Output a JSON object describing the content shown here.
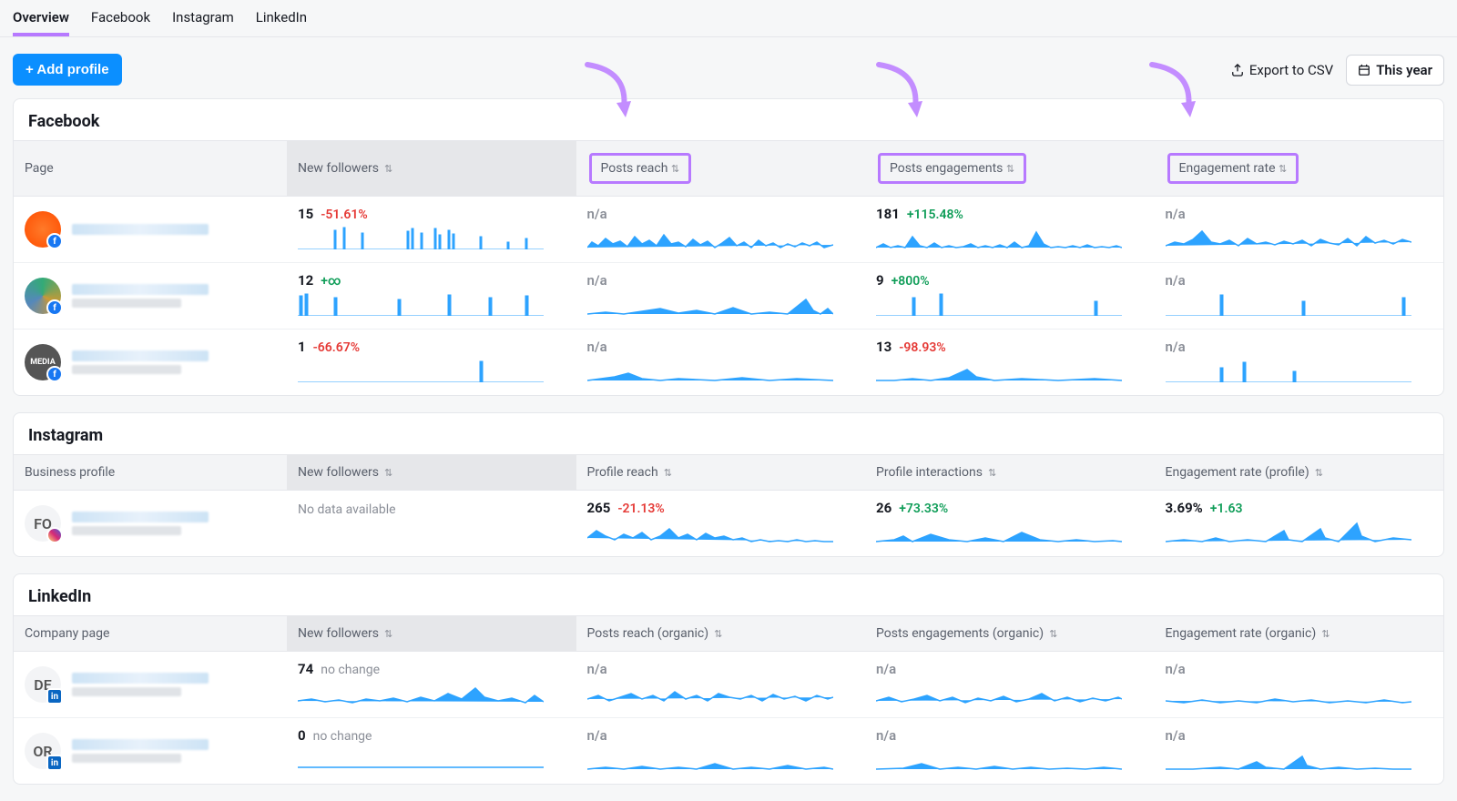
{
  "tabs": {
    "overview": "Overview",
    "facebook": "Facebook",
    "instagram": "Instagram",
    "linkedin": "LinkedIn"
  },
  "toolbar": {
    "add_profile": "+  Add profile",
    "export": "Export to CSV",
    "range": "This year"
  },
  "sections": {
    "facebook": {
      "title": "Facebook",
      "cols": {
        "page": "Page",
        "new_followers": "New followers",
        "posts_reach": "Posts reach",
        "posts_engagements": "Posts engagements",
        "engagement_rate": "Engagement rate"
      },
      "rows": [
        {
          "new_followers": {
            "v": "15",
            "d": "-51.61%",
            "cls": "neg"
          },
          "posts_reach": {
            "v": "n/a"
          },
          "posts_engagements": {
            "v": "181",
            "d": "+115.48%",
            "cls": "pos"
          },
          "engagement_rate": {
            "v": "n/a"
          }
        },
        {
          "new_followers": {
            "v": "12",
            "d": "+∞",
            "cls": "pos"
          },
          "posts_reach": {
            "v": "n/a"
          },
          "posts_engagements": {
            "v": "9",
            "d": "+800%",
            "cls": "pos"
          },
          "engagement_rate": {
            "v": "n/a"
          }
        },
        {
          "new_followers": {
            "v": "1",
            "d": "-66.67%",
            "cls": "neg"
          },
          "posts_reach": {
            "v": "n/a"
          },
          "posts_engagements": {
            "v": "13",
            "d": "-98.93%",
            "cls": "neg"
          },
          "engagement_rate": {
            "v": "n/a"
          }
        }
      ]
    },
    "instagram": {
      "title": "Instagram",
      "cols": {
        "page": "Business profile",
        "new_followers": "New followers",
        "profile_reach": "Profile reach",
        "profile_interactions": "Profile interactions",
        "engagement_rate": "Engagement rate (profile)"
      },
      "rows": [
        {
          "avatar": "FO",
          "new_followers": {
            "text": "No data available"
          },
          "profile_reach": {
            "v": "265",
            "d": "-21.13%",
            "cls": "neg"
          },
          "profile_interactions": {
            "v": "26",
            "d": "+73.33%",
            "cls": "pos"
          },
          "engagement_rate": {
            "v": "3.69%",
            "d": "+1.63",
            "cls": "pos"
          }
        }
      ]
    },
    "linkedin": {
      "title": "LinkedIn",
      "cols": {
        "page": "Company page",
        "new_followers": "New followers",
        "posts_reach": "Posts reach (organic)",
        "posts_engagements": "Posts engagements (organic)",
        "engagement_rate": "Engagement rate (organic)"
      },
      "rows": [
        {
          "avatar": "DE",
          "new_followers": {
            "v": "74",
            "d": "no change",
            "cls": "neu"
          },
          "posts_reach": {
            "v": "n/a"
          },
          "posts_engagements": {
            "v": "n/a"
          },
          "engagement_rate": {
            "v": "n/a"
          }
        },
        {
          "avatar": "OR",
          "new_followers": {
            "v": "0",
            "d": "no change",
            "cls": "neu"
          },
          "posts_reach": {
            "v": "n/a"
          },
          "posts_engagements": {
            "v": "n/a"
          },
          "engagement_rate": {
            "v": "n/a"
          }
        }
      ]
    }
  }
}
